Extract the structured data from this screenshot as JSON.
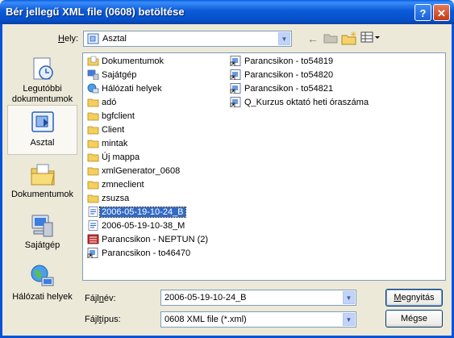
{
  "window": {
    "title": "Bér jellegű XML file (0608) betöltése"
  },
  "controls": {
    "help": "?",
    "close": "✕"
  },
  "location": {
    "label_underlined": "H",
    "label_rest": "ely:",
    "value": "Asztal"
  },
  "places": [
    {
      "label": "Legutóbbi dokumentumok",
      "icon": "recent-icon"
    },
    {
      "label": "Asztal",
      "icon": "desktop-icon"
    },
    {
      "label": "Dokumentumok",
      "icon": "documents-icon"
    },
    {
      "label": "Sajátgép",
      "icon": "computer-icon"
    },
    {
      "label": "Hálózati helyek",
      "icon": "network-icon"
    }
  ],
  "files_col1": [
    {
      "name": "Dokumentumok",
      "type": "docs"
    },
    {
      "name": "Sajátgép",
      "type": "pc"
    },
    {
      "name": "Hálózati helyek",
      "type": "net"
    },
    {
      "name": "adó",
      "type": "folder"
    },
    {
      "name": "bgfclient",
      "type": "folder"
    },
    {
      "name": "Client",
      "type": "folder"
    },
    {
      "name": "mintak",
      "type": "folder"
    },
    {
      "name": "Új mappa",
      "type": "folder"
    },
    {
      "name": "xmlGenerator_0608",
      "type": "folder"
    },
    {
      "name": "zmneclient",
      "type": "folder"
    },
    {
      "name": "zsuzsa",
      "type": "folder"
    },
    {
      "name": "2006-05-19-10-24_B",
      "type": "xml",
      "selected": true
    },
    {
      "name": "2006-05-19-10-38_M",
      "type": "xml"
    },
    {
      "name": "Parancsikon - NEPTUN (2)",
      "type": "app"
    },
    {
      "name": "Parancsikon - to46470",
      "type": "shortcut"
    }
  ],
  "files_col2": [
    {
      "name": "Parancsikon - to54819",
      "type": "shortcut"
    },
    {
      "name": "Parancsikon - to54820",
      "type": "shortcut"
    },
    {
      "name": "Parancsikon - to54821",
      "type": "shortcut"
    },
    {
      "name": "Q_Kurzus oktató heti óraszáma",
      "type": "shortcut"
    }
  ],
  "filename": {
    "label_pre": "Fájl",
    "label_underlined": "n",
    "label_post": "év:",
    "value": "2006-05-19-10-24_B"
  },
  "filetype": {
    "label_pre": "Fájl",
    "label_underlined": "t",
    "label_post": "ípus:",
    "value": "0608 XML file (*.xml)"
  },
  "buttons": {
    "open_underlined": "M",
    "open_rest": "egnyitás",
    "cancel": "Mégse"
  }
}
